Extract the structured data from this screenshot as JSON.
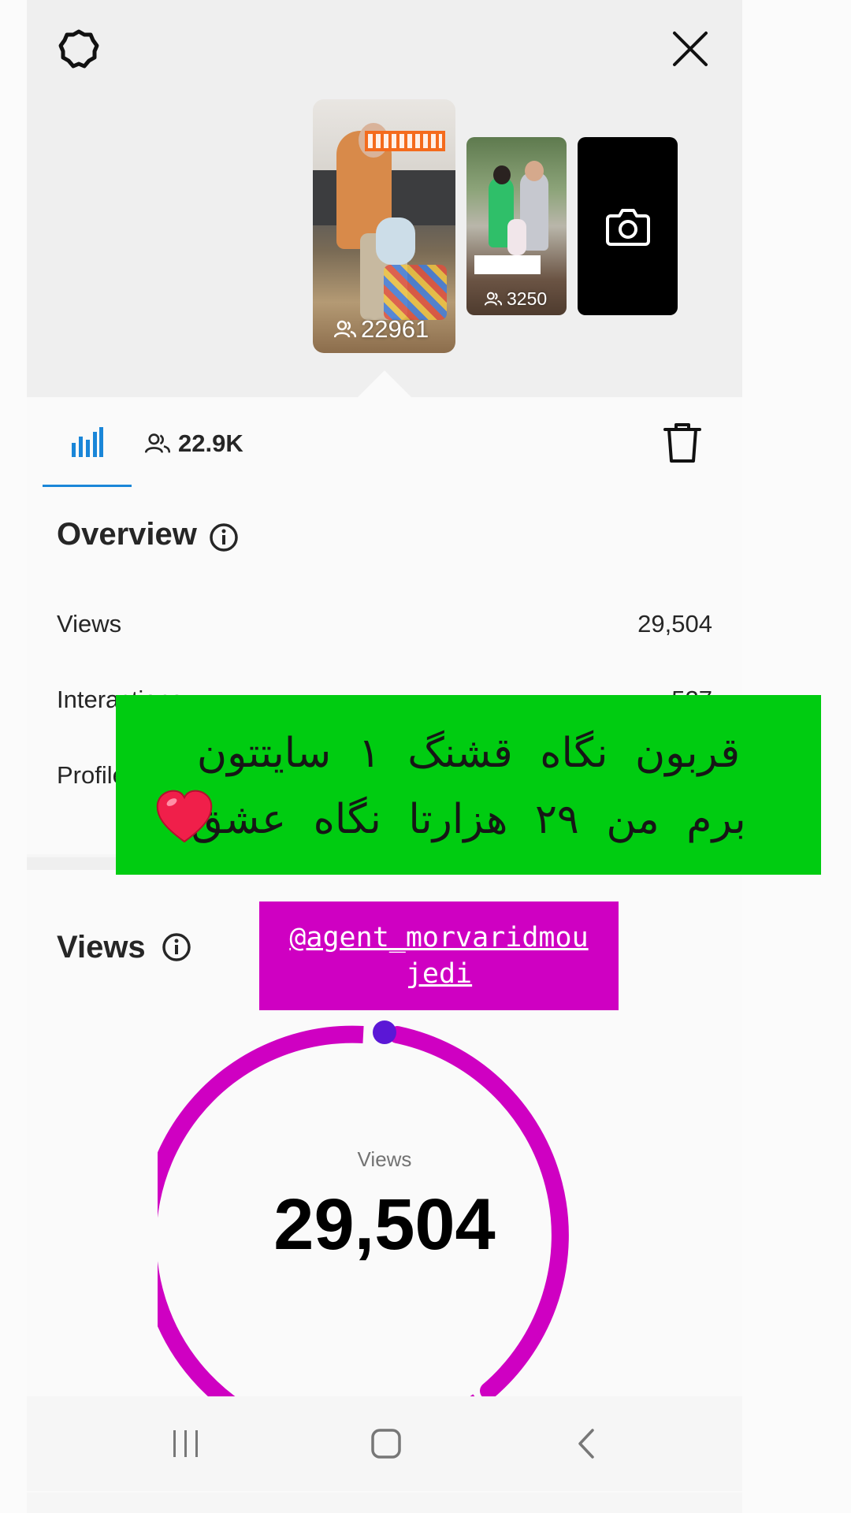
{
  "story_strip": {
    "stories": [
      {
        "viewers": "22961"
      },
      {
        "viewers": "3250"
      }
    ],
    "camera_label": ""
  },
  "tabs": {
    "viewers_count": "22.9K"
  },
  "overview": {
    "title": "Overview",
    "rows": [
      {
        "label": "Views",
        "value": "29,504"
      },
      {
        "label": "Interactions",
        "value": "527"
      },
      {
        "label": "Profile activity",
        "value": ""
      }
    ]
  },
  "views_section": {
    "title": "Views",
    "gauge_label": "Views",
    "gauge_value": "29,504"
  },
  "overlay_stickers": {
    "green_banner_line1": "قربون نگاه قشنگ ۱ سایتتون",
    "green_banner_line2": "برم من ۲۹ هزارتا نگاه عشق",
    "mention": "@agent_morvaridmoujedi"
  },
  "colors": {
    "accent_blue": "#1a86d8",
    "gauge_magenta": "#cf00c2",
    "gauge_dot": "#5b17d6",
    "banner_green": "#00cc11"
  }
}
